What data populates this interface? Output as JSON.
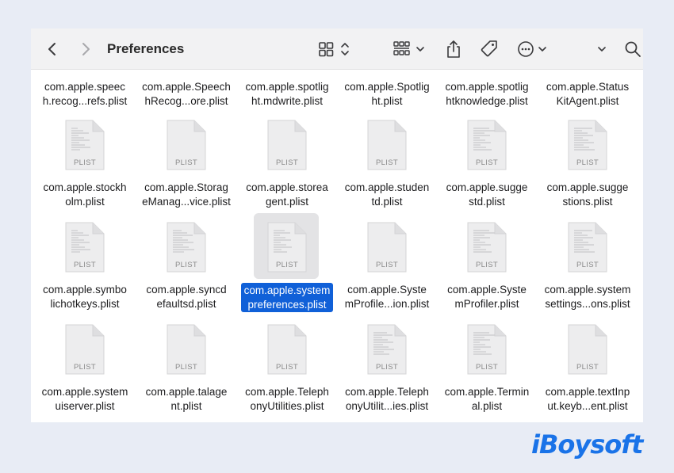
{
  "toolbar": {
    "title": "Preferences",
    "icons": [
      "chevron-left-icon",
      "chevron-right-icon",
      "icon-view-grid-icon",
      "sort-updown-icon",
      "group-view-icon",
      "chevron-down-icon",
      "share-icon",
      "tag-icon",
      "more-icon",
      "chevron-down-icon",
      "search-icon"
    ]
  },
  "files": {
    "row1": [
      {
        "l1": "com.apple.speec",
        "l2": "h.recog...refs.plist"
      },
      {
        "l1": "com.apple.Speech",
        "l2": "hRecog...ore.plist"
      },
      {
        "l1": "com.apple.spotlig",
        "l2": "ht.mdwrite.plist"
      },
      {
        "l1": "com.apple.Spotlig",
        "l2": "ht.plist"
      },
      {
        "l1": "com.apple.spotlig",
        "l2": "htknowledge.plist"
      },
      {
        "l1": "com.apple.Status",
        "l2": "KitAgent.plist"
      }
    ],
    "row2": [
      {
        "l1": "com.apple.stockh",
        "l2": "olm.plist",
        "badge": "PLIST"
      },
      {
        "l1": "com.apple.Storag",
        "l2": "eManag...vice.plist",
        "badge": "PLIST"
      },
      {
        "l1": "com.apple.storea",
        "l2": "gent.plist",
        "badge": "PLIST"
      },
      {
        "l1": "com.apple.studen",
        "l2": "td.plist",
        "badge": "PLIST"
      },
      {
        "l1": "com.apple.sugge",
        "l2": "std.plist",
        "badge": "PLIST"
      },
      {
        "l1": "com.apple.sugge",
        "l2": "stions.plist",
        "badge": "PLIST"
      }
    ],
    "row3": [
      {
        "l1": "com.apple.symbo",
        "l2": "lichotkeys.plist",
        "badge": "PLIST"
      },
      {
        "l1": "com.apple.syncd",
        "l2": "efaultsd.plist",
        "badge": "PLIST"
      },
      {
        "l1": "com.apple.system",
        "l2": "preferences.plist",
        "badge": "PLIST"
      },
      {
        "l1": "com.apple.Syste",
        "l2": "mProfile...ion.plist",
        "badge": "PLIST"
      },
      {
        "l1": "com.apple.Syste",
        "l2": "mProfiler.plist",
        "badge": "PLIST"
      },
      {
        "l1": "com.apple.system",
        "l2": "settings...ons.plist",
        "badge": "PLIST"
      }
    ],
    "row4": [
      {
        "l1": "com.apple.system",
        "l2": "uiserver.plist",
        "badge": "PLIST"
      },
      {
        "l1": "com.apple.talage",
        "l2": "nt.plist",
        "badge": "PLIST"
      },
      {
        "l1": "com.apple.Teleph",
        "l2": "onyUtilities.plist",
        "badge": "PLIST"
      },
      {
        "l1": "com.apple.Teleph",
        "l2": "onyUtilit...ies.plist",
        "badge": "PLIST"
      },
      {
        "l1": "com.apple.Termin",
        "l2": "al.plist",
        "badge": "PLIST"
      },
      {
        "l1": "com.apple.textInp",
        "l2": "ut.keyb...ent.plist",
        "badge": "PLIST"
      }
    ]
  },
  "brand": "iBoysoft",
  "colors": {
    "selection": "#1060d8",
    "brand": "#1a73e8"
  }
}
